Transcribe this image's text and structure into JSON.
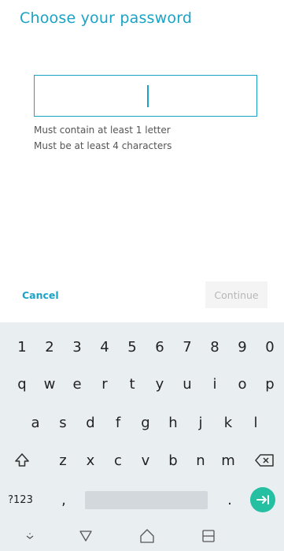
{
  "header": {
    "title": "Choose your password"
  },
  "password": {
    "value": ""
  },
  "hints": [
    "Must contain at least 1 letter",
    "Must be at least 4 characters"
  ],
  "actions": {
    "cancel_label": "Cancel",
    "continue_label": "Continue"
  },
  "keyboard": {
    "number_row": [
      "1",
      "2",
      "3",
      "4",
      "5",
      "6",
      "7",
      "8",
      "9",
      "0"
    ],
    "row1": [
      "q",
      "w",
      "e",
      "r",
      "t",
      "y",
      "u",
      "i",
      "o",
      "p"
    ],
    "row2": [
      "a",
      "s",
      "d",
      "f",
      "g",
      "h",
      "j",
      "k",
      "l"
    ],
    "row3": [
      "z",
      "x",
      "c",
      "v",
      "b",
      "n",
      "m"
    ],
    "symbols_label": "?123",
    "comma": ",",
    "period": "."
  },
  "colors": {
    "accent": "#1ba3c6",
    "enter": "#25bfa2",
    "keyboard_bg": "#e9eef1"
  },
  "icons": [
    "shift-icon",
    "backspace-icon",
    "enter-icon",
    "nav-collapse-icon",
    "nav-back-icon",
    "nav-home-icon",
    "nav-recents-icon"
  ]
}
